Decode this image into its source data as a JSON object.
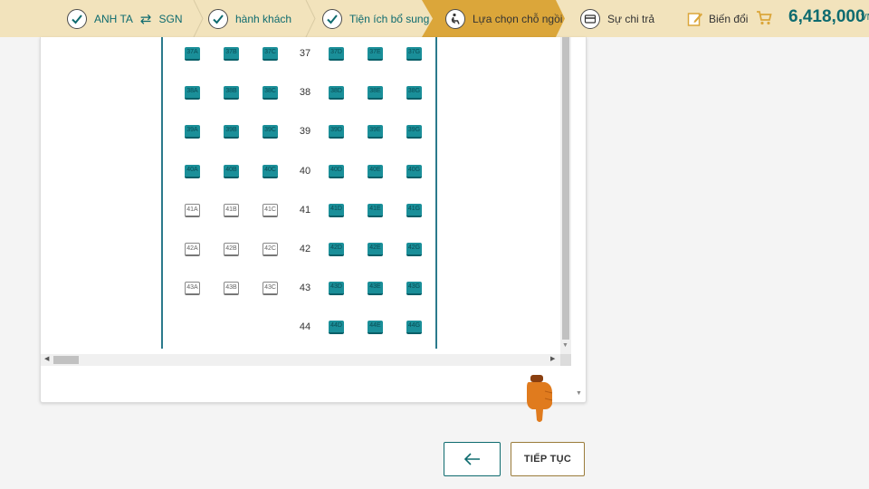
{
  "steps": {
    "route": {
      "origin": "ANH TA",
      "arrow_icon": "swap-arrows-icon",
      "destination": "SGN",
      "status_icon": "check-icon"
    },
    "passengers": {
      "label": "hành khách",
      "status_icon": "check-icon"
    },
    "extras": {
      "label": "Tiện ích bổ sung",
      "status_icon": "check-icon"
    },
    "seat_selection": {
      "label": "Lựa chọn chỗ ngồi",
      "icon": "seat-icon",
      "active": true
    },
    "payment": {
      "label": "Sự chi trả",
      "icon": "credit-card-icon"
    }
  },
  "header": {
    "modify_label": "Biến đổi",
    "modify_icon": "edit-icon",
    "cart_icon": "cart-icon",
    "total_price": "6,418,000",
    "currency": "VN"
  },
  "seat_map": {
    "rows": [
      {
        "row": "37",
        "left": [
          {
            "id": "37A",
            "status": "occupied"
          },
          {
            "id": "37B",
            "status": "occupied"
          },
          {
            "id": "37C",
            "status": "occupied"
          }
        ],
        "right": [
          {
            "id": "37D",
            "status": "occupied"
          },
          {
            "id": "37E",
            "status": "occupied"
          },
          {
            "id": "37G",
            "status": "occupied"
          }
        ]
      },
      {
        "row": "38",
        "left": [
          {
            "id": "38A",
            "status": "occupied"
          },
          {
            "id": "38B",
            "status": "occupied"
          },
          {
            "id": "38C",
            "status": "occupied"
          }
        ],
        "right": [
          {
            "id": "38D",
            "status": "occupied"
          },
          {
            "id": "38E",
            "status": "occupied"
          },
          {
            "id": "38G",
            "status": "occupied"
          }
        ]
      },
      {
        "row": "39",
        "left": [
          {
            "id": "39A",
            "status": "occupied"
          },
          {
            "id": "39B",
            "status": "occupied"
          },
          {
            "id": "39C",
            "status": "occupied"
          }
        ],
        "right": [
          {
            "id": "39D",
            "status": "occupied"
          },
          {
            "id": "39E",
            "status": "occupied"
          },
          {
            "id": "39G",
            "status": "occupied"
          }
        ]
      },
      {
        "row": "40",
        "left": [
          {
            "id": "40A",
            "status": "occupied"
          },
          {
            "id": "40B",
            "status": "occupied"
          },
          {
            "id": "40C",
            "status": "occupied"
          }
        ],
        "right": [
          {
            "id": "40D",
            "status": "occupied"
          },
          {
            "id": "40E",
            "status": "occupied"
          },
          {
            "id": "40G",
            "status": "occupied"
          }
        ]
      },
      {
        "row": "41",
        "left": [
          {
            "id": "41A",
            "status": "available"
          },
          {
            "id": "41B",
            "status": "available"
          },
          {
            "id": "41C",
            "status": "available"
          }
        ],
        "right": [
          {
            "id": "41D",
            "status": "occupied"
          },
          {
            "id": "41E",
            "status": "occupied"
          },
          {
            "id": "41G",
            "status": "occupied"
          }
        ]
      },
      {
        "row": "42",
        "left": [
          {
            "id": "42A",
            "status": "available"
          },
          {
            "id": "42B",
            "status": "available"
          },
          {
            "id": "42C",
            "status": "available"
          }
        ],
        "right": [
          {
            "id": "42D",
            "status": "occupied"
          },
          {
            "id": "42E",
            "status": "occupied"
          },
          {
            "id": "42G",
            "status": "occupied"
          }
        ]
      },
      {
        "row": "43",
        "left": [
          {
            "id": "43A",
            "status": "available"
          },
          {
            "id": "43B",
            "status": "available"
          },
          {
            "id": "43C",
            "status": "available"
          }
        ],
        "right": [
          {
            "id": "43D",
            "status": "occupied"
          },
          {
            "id": "43E",
            "status": "occupied"
          },
          {
            "id": "43G",
            "status": "occupied"
          }
        ]
      },
      {
        "row": "44",
        "left": [],
        "right": [
          {
            "id": "44D",
            "status": "occupied"
          },
          {
            "id": "44E",
            "status": "occupied"
          },
          {
            "id": "44G",
            "status": "occupied"
          }
        ]
      }
    ]
  },
  "buttons": {
    "back_icon": "arrow-left-icon",
    "continue_label": "TIẾP TỤC"
  },
  "colors": {
    "header_bg": "#f2e3bc",
    "active_step": "#dba63a",
    "brand_teal": "#0e6b6f",
    "seat_occupied": "#1a8f99"
  }
}
